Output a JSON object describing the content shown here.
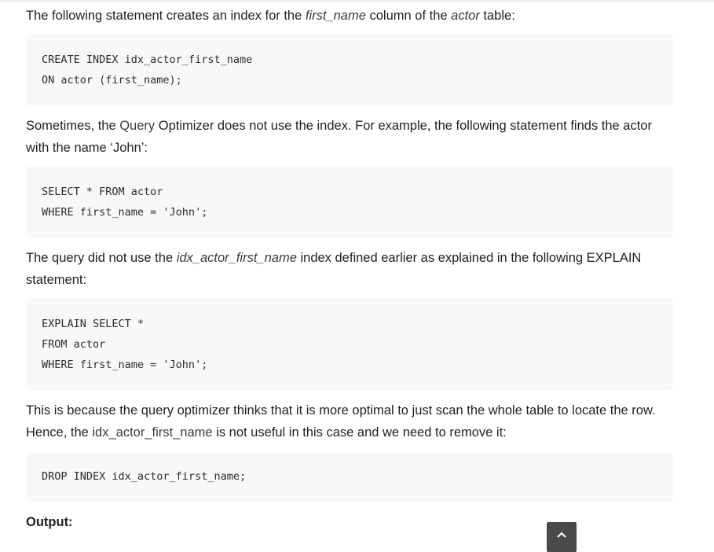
{
  "paragraphs": {
    "p1": {
      "before": "The following statement creates an index for the ",
      "em1": "first_name",
      "mid": " column of the ",
      "em2": "actor",
      "after": " table:"
    },
    "p2": {
      "before": "Sometimes, the ",
      "highlight": "Query",
      "after": " Optimizer does not use the index. For example, the following statement finds the actor with the name ‘John’:"
    },
    "p3": {
      "before": "The query did not use the ",
      "em": "idx_actor_first_name",
      "after": " index defined earlier as explained in the following EXPLAIN statement:"
    },
    "p4": {
      "before": "This is because the query optimizer thinks that it is more optimal to just scan the whole table to locate the row. Hence, the ",
      "highlight": "idx_actor_first_name",
      "after": " is not useful in this case and we need to remove it:"
    }
  },
  "code_blocks": [
    {
      "lines": [
        "CREATE INDEX idx_actor_first_name",
        "ON actor (first_name);"
      ]
    },
    {
      "lines": [
        "SELECT * FROM actor",
        "WHERE first_name = 'John';"
      ]
    },
    {
      "lines": [
        "EXPLAIN SELECT *",
        "FROM actor",
        "WHERE first_name = 'John';"
      ]
    },
    {
      "lines": [
        "DROP INDEX idx_actor_first_name;"
      ]
    }
  ],
  "output_label": "Output:",
  "scroll_top_button": {
    "icon": "arrow-up-icon"
  }
}
